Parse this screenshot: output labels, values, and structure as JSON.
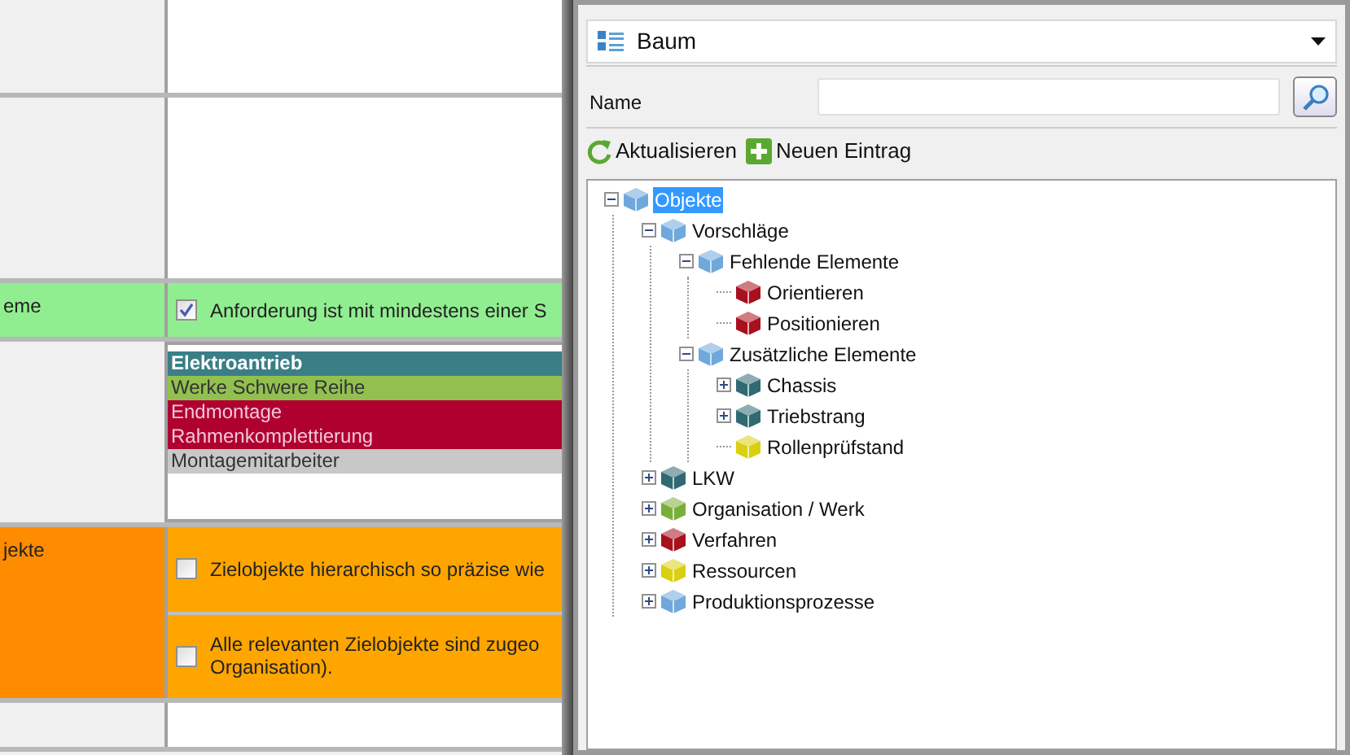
{
  "form": {
    "rows": [
      {
        "kind": "blank",
        "label": ""
      },
      {
        "kind": "blank",
        "label": ""
      },
      {
        "kind": "check",
        "label": "eme",
        "color": "#90ee90",
        "items": [
          {
            "text": "Anforderung ist mit mindestens einer S",
            "checked": true
          }
        ]
      },
      {
        "kind": "list",
        "label": "",
        "items": [
          {
            "text": "Elektroantrieb",
            "color": "#3a7e86",
            "bold": true
          },
          {
            "text": "Werke Schwere Reihe",
            "color": "#92c050",
            "bold": false
          },
          {
            "text": "Endmontage",
            "color": "#b00030",
            "bold": false
          },
          {
            "text": "Rahmenkomplettierung",
            "color": "#b00030",
            "bold": false
          },
          {
            "text": "Montagemitarbeiter",
            "color": "#c8c8c8",
            "bold": false
          }
        ]
      },
      {
        "kind": "check",
        "label": "jekte",
        "color": "#ff8c00",
        "items": [
          {
            "text": "Zielobjekte hierarchisch so präzise wie",
            "checked": false
          },
          {
            "text": "Alle relevanten Zielobjekte sind zugeo\nOrganisation).",
            "checked": false
          }
        ]
      },
      {
        "kind": "blank",
        "label": ""
      }
    ]
  },
  "panel": {
    "view_select": {
      "value": "Baum"
    },
    "name_label": "Name",
    "toolbar": [
      "Aktualisieren",
      "Neuen Eintrag"
    ],
    "tree": [
      {
        "label": "Objekte",
        "color": "#6fa8dc",
        "selected": true,
        "expanded": true,
        "children": [
          {
            "label": "Vorschläge",
            "color": "#6fa8dc",
            "selected": false,
            "expanded": true,
            "children": [
              {
                "label": "Fehlende Elemente",
                "color": "#6fa8dc",
                "selected": false,
                "expanded": true,
                "children": [
                  {
                    "label": "Orientieren",
                    "color": "#a8101e",
                    "selected": false
                  },
                  {
                    "label": "Positionieren",
                    "color": "#a8101e",
                    "selected": false
                  }
                ]
              },
              {
                "label": "Zusätzliche Elemente",
                "color": "#6fa8dc",
                "selected": false,
                "expanded": true,
                "children": [
                  {
                    "label": "Chassis",
                    "color": "#2f6a72",
                    "selected": false,
                    "expanded": false
                  },
                  {
                    "label": "Triebstrang",
                    "color": "#2f6a72",
                    "selected": false,
                    "expanded": false
                  },
                  {
                    "label": "Rollenprüfstand",
                    "color": "#d8d010",
                    "selected": false
                  }
                ]
              }
            ]
          },
          {
            "label": "LKW",
            "color": "#2f6a72",
            "selected": false,
            "expanded": false
          },
          {
            "label": "Organisation / Werk",
            "color": "#7aae3a",
            "selected": false,
            "expanded": false
          },
          {
            "label": "Verfahren",
            "color": "#a8101e",
            "selected": false,
            "expanded": false
          },
          {
            "label": "Ressourcen",
            "color": "#d8d010",
            "selected": false,
            "expanded": false
          },
          {
            "label": "Produktionsprozesse",
            "color": "#6fa8dc",
            "selected": false,
            "expanded": false
          }
        ]
      }
    ]
  }
}
